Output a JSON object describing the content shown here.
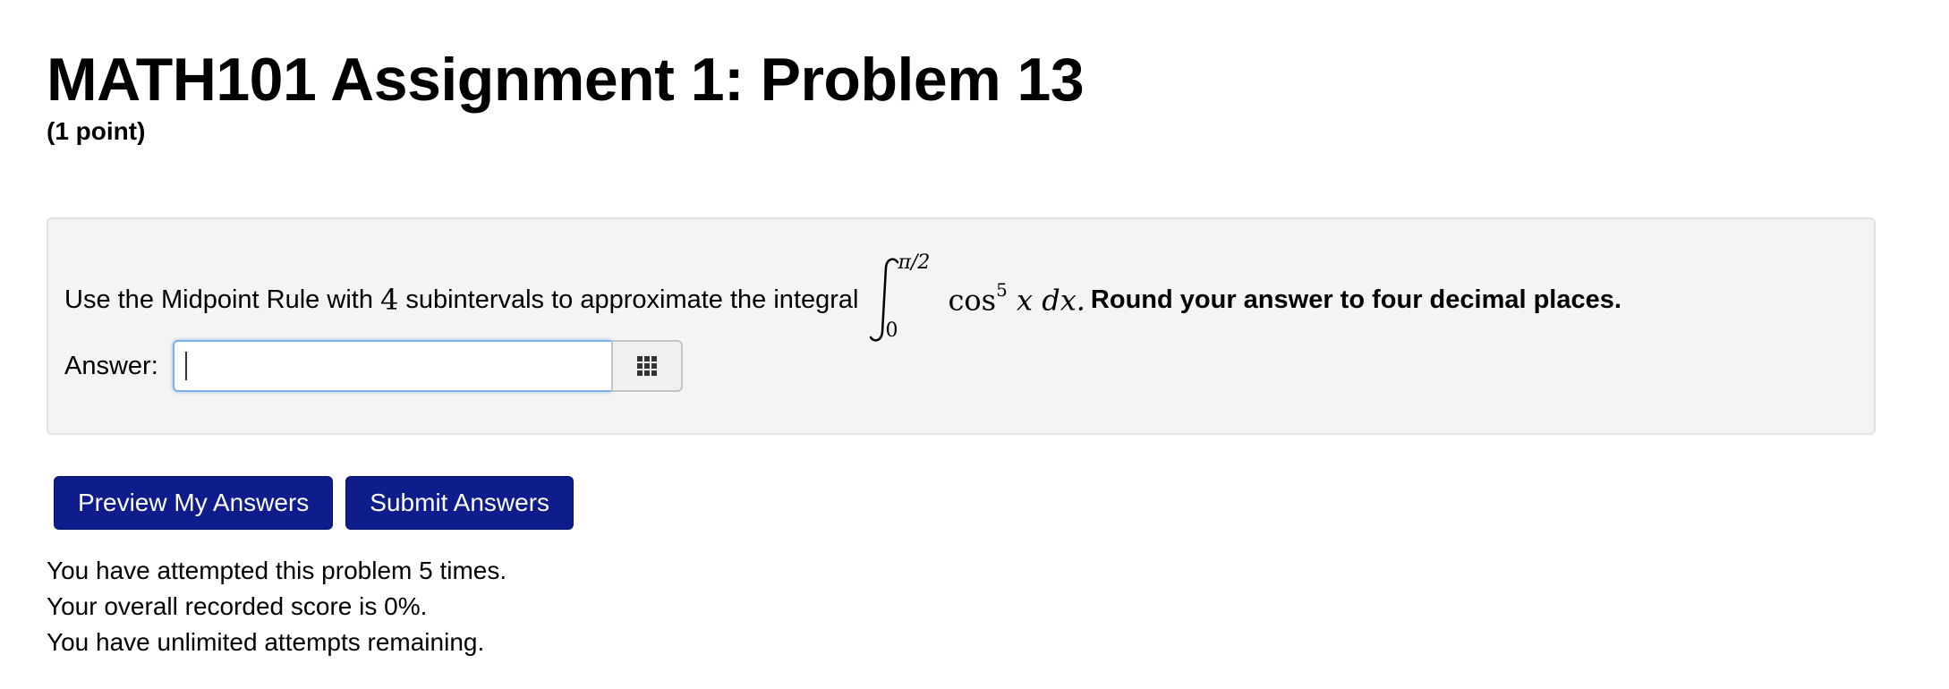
{
  "header": {
    "title": "MATH101 Assignment 1: Problem 13",
    "points": "(1 point)"
  },
  "problem": {
    "text_before": "Use the Midpoint Rule with",
    "subintervals": "4",
    "text_middle": "subintervals to approximate the integral",
    "integral_upper": "π/2",
    "integral_lower": "0",
    "integrand_func": "cos",
    "integrand_power": "5",
    "integrand_rest": "x dx.",
    "instruction": "Round your answer to four decimal places."
  },
  "answer": {
    "label": "Answer:",
    "value": "",
    "grid_icon": "grid-icon"
  },
  "buttons": {
    "preview_label": "Preview My Answers",
    "submit_label": "Submit Answers"
  },
  "status": {
    "attempts": "You have attempted this problem 5 times.",
    "score": "Your overall recorded score is 0%.",
    "remaining": "You have unlimited attempts remaining."
  },
  "colors": {
    "button_bg": "#0e1c8c",
    "problem_bg": "#f4f4f4",
    "input_focus": "#7fb0e6"
  }
}
